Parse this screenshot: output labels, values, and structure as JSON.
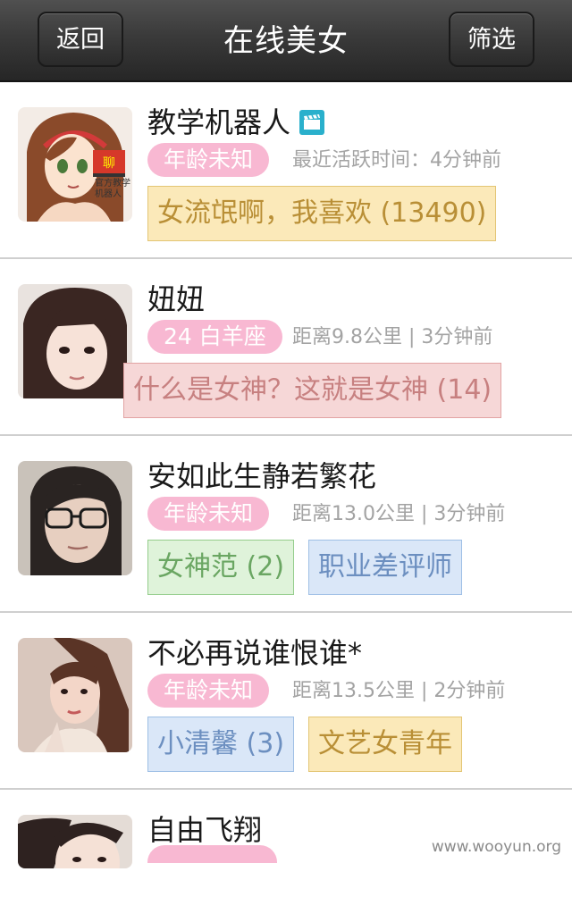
{
  "header": {
    "title": "在线美女",
    "back_label": "返回",
    "filter_label": "筛选"
  },
  "users": [
    {
      "name": "教学机器人",
      "age_label": "年龄未知",
      "meta": "最近活跃时间：4分钟前",
      "avatar_caption": "官方教学机器人",
      "tags": [
        {
          "text": "女流氓啊，我喜欢 (13490)",
          "color": "yellow"
        }
      ]
    },
    {
      "name": "妞妞",
      "age_label": "24 白羊座",
      "meta": "距离9.8公里 | 3分钟前",
      "tags": [
        {
          "text": "什么是女神？这就是女神 (14)",
          "color": "red"
        }
      ]
    },
    {
      "name": "安如此生静若繁花",
      "age_label": "年龄未知",
      "meta": "距离13.0公里 | 3分钟前",
      "tags": [
        {
          "text": "女神范 (2)",
          "color": "green"
        },
        {
          "text": "职业差评师",
          "color": "blue"
        }
      ]
    },
    {
      "name": "不必再说谁恨谁*",
      "age_label": "年龄未知",
      "meta": "距离13.5公里 | 2分钟前",
      "tags": [
        {
          "text": "小清馨 (3)",
          "color": "blue"
        },
        {
          "text": "文艺女青年",
          "color": "yellow"
        }
      ]
    },
    {
      "name": "自由飞翔"
    }
  ],
  "watermark": "www.wooyun.org",
  "colors": {
    "age_pill": "#f8b8d2",
    "header_bg": "#3a3a3a",
    "tag_yellow": "#fbe9b9",
    "tag_red": "#f6d7d7",
    "tag_green": "#dff3da",
    "tag_blue": "#dae7f8"
  }
}
